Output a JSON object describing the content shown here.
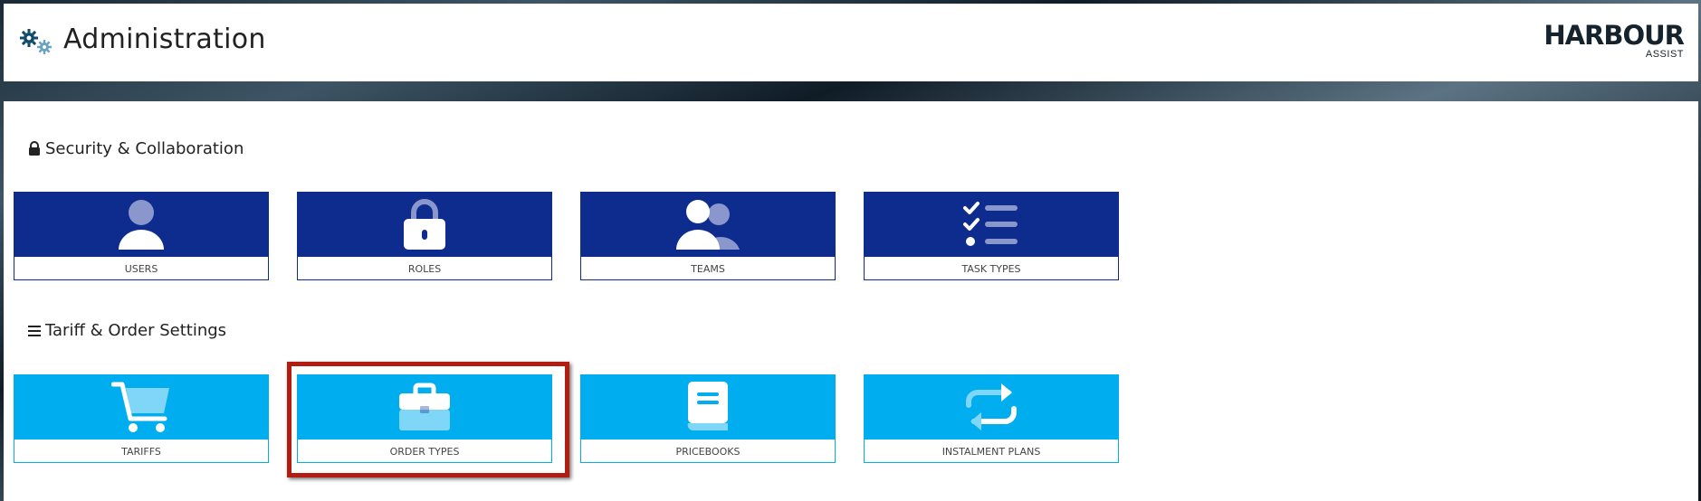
{
  "header": {
    "title": "Administration",
    "icon": "gears-icon",
    "logo": {
      "main": "HARBOUR",
      "sub": "ASSIST"
    }
  },
  "sections": [
    {
      "title": "Security & Collaboration",
      "icon": "lock-icon",
      "tiles": [
        {
          "label": "USERS",
          "icon": "user-icon"
        },
        {
          "label": "ROLES",
          "icon": "padlock-icon"
        },
        {
          "label": "TEAMS",
          "icon": "team-icon"
        },
        {
          "label": "TASK TYPES",
          "icon": "checklist-icon"
        }
      ]
    },
    {
      "title": "Tariff & Order Settings",
      "icon": "list-icon",
      "tiles": [
        {
          "label": "TARIFFS",
          "icon": "cart-icon"
        },
        {
          "label": "ORDER TYPES",
          "icon": "briefcase-icon",
          "highlighted": true
        },
        {
          "label": "PRICEBOOKS",
          "icon": "book-icon"
        },
        {
          "label": "INSTALMENT PLANS",
          "icon": "repeat-icon"
        }
      ]
    }
  ],
  "colors": {
    "security_tile": "#0d2c8e",
    "tariff_tile": "#00adee",
    "highlight": "#b31c10"
  }
}
